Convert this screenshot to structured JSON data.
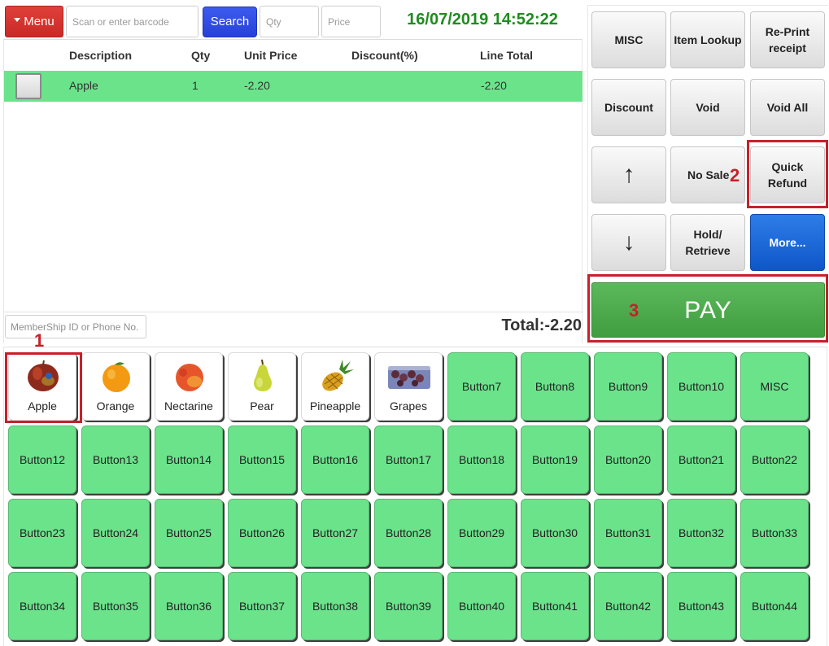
{
  "header": {
    "menu_label": "Menu",
    "barcode_placeholder": "Scan or enter barcode",
    "search_label": "Search",
    "qty_placeholder": "Qty",
    "price_placeholder": "Price",
    "datetime": "16/07/2019 14:52:22"
  },
  "ticket": {
    "columns": [
      "Description",
      "Qty",
      "Unit Price",
      "Discount(%)",
      "Line Total"
    ],
    "rows": [
      {
        "description": "Apple",
        "qty": "1",
        "unit_price": "-2.20",
        "discount": "",
        "line_total": "-2.20"
      }
    ],
    "membership_placeholder": "MemberShip ID or Phone No.",
    "total": "Total:-2.20"
  },
  "functions": {
    "misc": "MISC",
    "item_lookup": "Item Lookup",
    "reprint": "Re-Print receipt",
    "discount": "Discount",
    "void": "Void",
    "void_all": "Void All",
    "up_arrow": "↑",
    "no_sale": "No Sale",
    "quick_refund": "Quick Refund",
    "down_arrow": "↓",
    "hold_retrieve": "Hold/ Retrieve",
    "more": "More...",
    "pay": "PAY"
  },
  "annotations": {
    "a1": "1",
    "a2": "2",
    "a3": "3"
  },
  "products": [
    {
      "label": "Apple",
      "icon": "apple-icon"
    },
    {
      "label": "Orange",
      "icon": "orange-icon"
    },
    {
      "label": "Nectarine",
      "icon": "nectarine-icon"
    },
    {
      "label": "Pear",
      "icon": "pear-icon"
    },
    {
      "label": "Pineapple",
      "icon": "pineapple-icon"
    },
    {
      "label": "Grapes",
      "icon": "grapes-icon"
    }
  ],
  "grid_buttons": [
    "Button7",
    "Button8",
    "Button9",
    "Button10",
    "MISC",
    "Button12",
    "Button13",
    "Button14",
    "Button15",
    "Button16",
    "Button17",
    "Button18",
    "Button19",
    "Button20",
    "Button21",
    "Button22",
    "Button23",
    "Button24",
    "Button25",
    "Button26",
    "Button27",
    "Button28",
    "Button29",
    "Button30",
    "Button31",
    "Button32",
    "Button33",
    "Button34",
    "Button35",
    "Button36",
    "Button37",
    "Button38",
    "Button39",
    "Button40",
    "Button41",
    "Button42",
    "Button43",
    "Button44"
  ],
  "colors": {
    "accent_green": "#6be38b",
    "pay_green": "#4caf50",
    "menu_red": "#d9342f",
    "search_blue": "#3350e6",
    "more_blue": "#1565d8",
    "datetime_green": "#1e8c1e",
    "annotation_red": "#c8202a"
  }
}
